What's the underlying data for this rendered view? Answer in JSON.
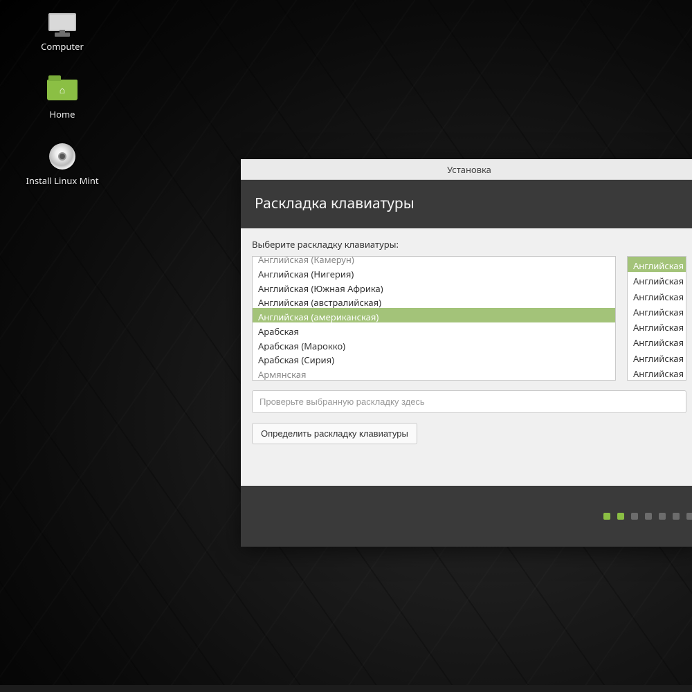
{
  "desktop": {
    "icons": [
      {
        "label": "Computer"
      },
      {
        "label": "Home"
      },
      {
        "label": "Install Linux Mint"
      }
    ]
  },
  "installer": {
    "window_title": "Установка",
    "heading": "Раскладка клавиатуры",
    "prompt": "Выберите раскладку клавиатуры:",
    "left_list": [
      "Английская (Камерун)",
      "Английская (Нигерия)",
      "Английская (Южная Африка)",
      "Английская (австралийская)",
      "Английская (американская)",
      "Арабская",
      "Арабская (Марокко)",
      "Арабская (Сирия)",
      "Армянская"
    ],
    "left_selected_index": 4,
    "right_list": [
      "Английская (а",
      "Английская (а",
      "Английская (а",
      "Английская (а",
      "Английская (а",
      "Английская (а",
      "Английская (а",
      "Английская (а"
    ],
    "right_selected_index": 0,
    "test_placeholder": "Проверьте выбранную раскладку здесь",
    "detect_button": "Определить раскладку клавиатуры",
    "progress": {
      "total": 7,
      "done": 2
    }
  }
}
